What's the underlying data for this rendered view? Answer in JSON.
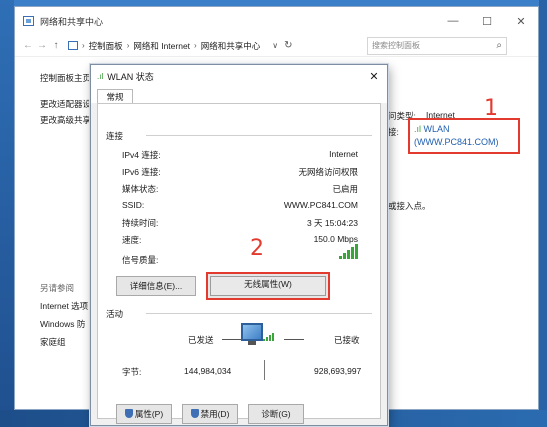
{
  "window": {
    "title": "网络和共享中心",
    "controls": {
      "minimize": "—",
      "maximize": "☐",
      "close": "✕"
    }
  },
  "address": {
    "back": "←",
    "forward": "→",
    "up": "↑",
    "crumbs": [
      "控制面板",
      "网络和 Internet",
      "网络和共享中心"
    ],
    "separator": "›",
    "dropdown": "∨",
    "refresh": "↻",
    "search_placeholder": "搜索控制面板",
    "search_icon": "⌕"
  },
  "left_pane": {
    "home": "控制面板主页",
    "change_adapter": "更改适配器设",
    "change_advanced": "更改高级共享",
    "see_also": "另请参阅",
    "internet_options": "Internet 选项",
    "windows_firewall": "Windows 防",
    "homegroup": "家庭组"
  },
  "right_pane": {
    "access_type_label": "问类型:",
    "access_type_value": "Internet",
    "connections_label": "接:",
    "wlan_line1": "WLAN",
    "wlan_line2": "(WWW.PC841.COM)",
    "router_fragment": "或接入点。"
  },
  "annotations": {
    "num1": "1",
    "num2": "2",
    "color": "#e23a2e"
  },
  "dialog": {
    "title": "WLAN 状态",
    "close": "✕",
    "tab": "常规",
    "connection_header": "连接",
    "rows": [
      {
        "label": "IPv4 连接:",
        "value": "Internet"
      },
      {
        "label": "IPv6 连接:",
        "value": "无网络访问权限"
      },
      {
        "label": "媒体状态:",
        "value": "已启用"
      },
      {
        "label": "SSID:",
        "value": "WWW.PC841.COM"
      },
      {
        "label": "持续时间:",
        "value": "3 天 15:04:23"
      },
      {
        "label": "速度:",
        "value": "150.0 Mbps"
      }
    ],
    "signal_label": "信号质量:",
    "signal_bars": 5,
    "details_button": "详细信息(E)...",
    "wireless_props_button": "无线属性(W)",
    "activity_header": "活动",
    "sent_label": "已发送",
    "received_label": "已接收",
    "bytes_label": "字节:",
    "bytes_sent": "144,984,034",
    "bytes_received": "928,693,997",
    "properties_button": "属性(P)",
    "disable_button": "禁用(D)",
    "diagnose_button": "诊断(G)"
  }
}
